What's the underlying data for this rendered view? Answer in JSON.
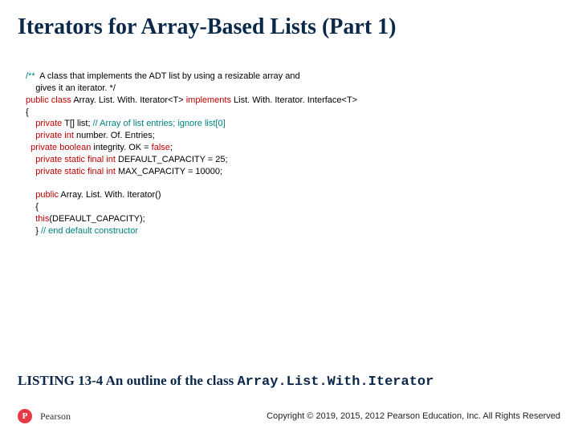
{
  "title": "Iterators for Array-Based Lists (Part 1)",
  "code": {
    "l1a": "/**",
    "l1b": "  A class that implements the ADT list by using a resizable array and",
    "l2": "    gives it an iterator. */",
    "l3a": "public",
    "l3b": " class",
    "l3c": " Array. List. With. Iterator<T> ",
    "l3d": "implements",
    "l3e": " List. With. Iterator. Interface<T>",
    "l4": "{",
    "l5a": "    private",
    "l5b": " T[] list; ",
    "l5c": "// Array of list entries; ignore list[0]",
    "l6a": "    private",
    "l6b": " int",
    "l6c": " number. Of. Entries;",
    "l7a": "  private",
    "l7b": " boolean",
    "l7c": " integrity. OK = ",
    "l7d": "false",
    "l7e": ";",
    "l8a": "    private",
    "l8b": " static final int",
    "l8c": " DEFAULT_CAPACITY = 25;",
    "l9a": "    private",
    "l9b": " static final int",
    "l9c": " MAX_CAPACITY = 10000;",
    "l10a": "    public",
    "l10b": " Array. List. With. Iterator()",
    "l11": "    {",
    "l12a": "    this",
    "l12b": "(DEFAULT_CAPACITY);",
    "l13a": "    } ",
    "l13b": "// end default constructor"
  },
  "caption": {
    "prefix": "LISTING 13-4 An outline of the class ",
    "classname": "Array.List.With.Iterator"
  },
  "footer": {
    "brand": "Pearson",
    "copyright": "Copyright © 2019, 2015, 2012 Pearson Education, Inc. All Rights Reserved"
  }
}
